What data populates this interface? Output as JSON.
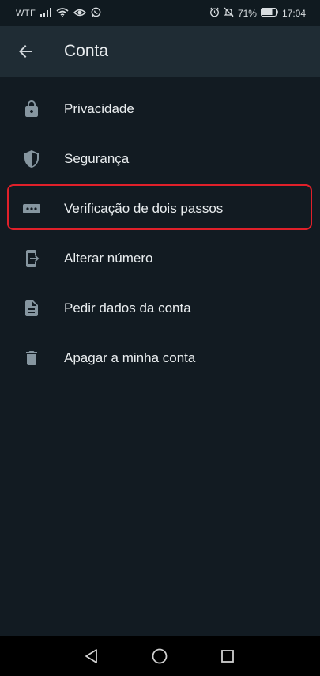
{
  "status_bar": {
    "carrier": "WTF",
    "battery": "71%",
    "time": "17:04",
    "icons": [
      "signal-icon",
      "wifi-icon",
      "eye-icon",
      "whatsapp-icon",
      "alarm-icon",
      "mute-icon",
      "battery-icon"
    ]
  },
  "app_bar": {
    "title": "Conta",
    "back_icon": "arrow-left-icon"
  },
  "menu": {
    "items": [
      {
        "label": "Privacidade",
        "icon": "lock-icon"
      },
      {
        "label": "Segurança",
        "icon": "shield-icon"
      },
      {
        "label": "Verificação de dois passos",
        "icon": "dots-password-icon",
        "highlighted": true
      },
      {
        "label": "Alterar número",
        "icon": "phone-change-icon"
      },
      {
        "label": "Pedir dados da conta",
        "icon": "document-icon"
      },
      {
        "label": "Apagar a minha conta",
        "icon": "trash-icon"
      }
    ]
  },
  "nav_bar": {
    "buttons": [
      "back-triangle-icon",
      "home-circle-icon",
      "recents-square-icon"
    ]
  },
  "colors": {
    "background": "#121b22",
    "app_bar": "#1f2c34",
    "icon": "#8696a0",
    "highlight_border": "#e0202a"
  }
}
